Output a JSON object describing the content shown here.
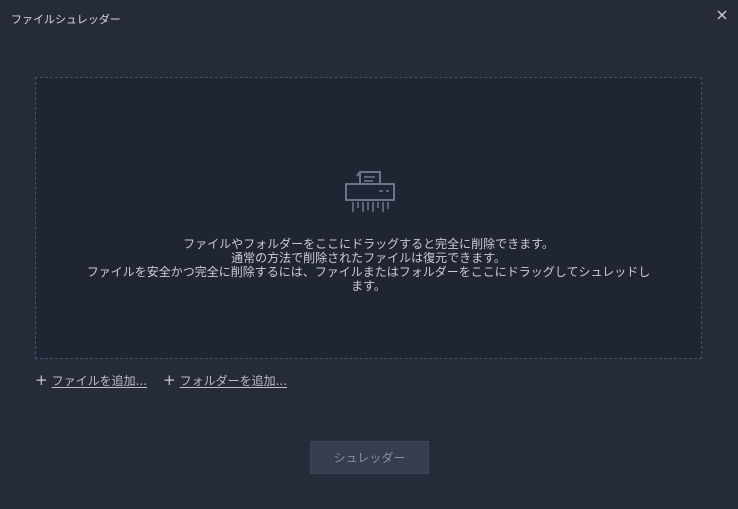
{
  "window": {
    "title": "ファイルシュレッダー"
  },
  "dropzone": {
    "icon": "shredder-icon",
    "message_lines": [
      "ファイルやフォルダーをここにドラッグすると完全に削除できます。",
      "通常の方法で削除されたファイルは復元できます。",
      "ファイルを安全かつ完全に削除するには、ファイルまたはフォルダーをここにドラッグしてシュレッドし",
      "ます。"
    ]
  },
  "actions": {
    "add_file_label": "ファイルを追加...",
    "add_folder_label": "フォルダーを追加..."
  },
  "footer": {
    "shred_label": "シュレッダー"
  },
  "colors": {
    "background": "#262b3a",
    "dropzone_bg": "#202533",
    "button_disabled": "#383d4d"
  }
}
